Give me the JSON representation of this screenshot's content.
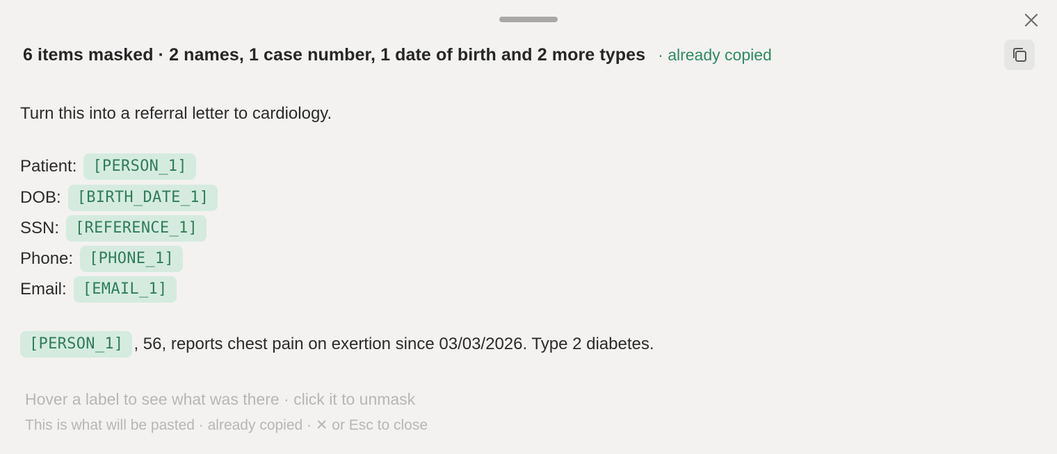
{
  "header": {
    "summary": "6 items masked · 2 names, 1 case number, 1 date of birth and 2 more types",
    "status": "· already copied"
  },
  "icons": {
    "close": "close-icon",
    "copy": "copy-icon",
    "drag": "drag-handle"
  },
  "colors": {
    "background": "#f3f2f1",
    "accent_green": "#2f8a5f",
    "token_background": "#d5ebe0",
    "muted_text": "#b7b6b4"
  },
  "content": {
    "instruction": "Turn this into a referral letter to cardiology.",
    "fields": [
      {
        "label": "Patient:",
        "token": "[PERSON_1]"
      },
      {
        "label": "DOB:",
        "token": "[BIRTH_DATE_1]"
      },
      {
        "label": "SSN:",
        "token": "[REFERENCE_1]"
      },
      {
        "label": "Phone:",
        "token": "[PHONE_1]"
      },
      {
        "label": "Email:",
        "token": "[EMAIL_1]"
      }
    ],
    "narrative": {
      "token": "[PERSON_1]",
      "text": ", 56, reports chest pain on exertion since 03/03/2026. Type 2 diabetes."
    }
  },
  "footer": {
    "hint": "Hover a label to see what was there · click it to unmask",
    "info": "This is what will be pasted · already copied · ✕ or Esc to close"
  }
}
